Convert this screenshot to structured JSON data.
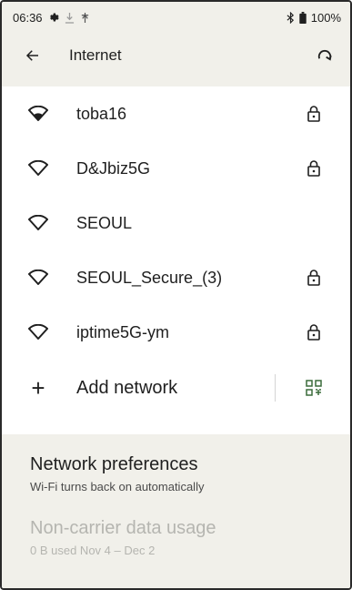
{
  "status_bar": {
    "time": "06:36",
    "battery": "100%"
  },
  "header": {
    "title": "Internet"
  },
  "networks": [
    {
      "name": "toba16",
      "secured": true,
      "connected_style": "filled"
    },
    {
      "name": "D&Jbiz5G",
      "secured": true,
      "connected_style": "outline"
    },
    {
      "name": "SEOUL",
      "secured": false,
      "connected_style": "outline"
    },
    {
      "name": "SEOUL_Secure_(3)",
      "secured": true,
      "connected_style": "outline"
    },
    {
      "name": "iptime5G-ym",
      "secured": true,
      "connected_style": "outline"
    }
  ],
  "add_network": {
    "label": "Add network"
  },
  "preferences": [
    {
      "title": "Network preferences",
      "subtitle": "Wi-Fi turns back on automatically",
      "disabled": false
    },
    {
      "title": "Non-carrier data usage",
      "subtitle": "0 B used Nov 4 – Dec 2",
      "disabled": true
    }
  ],
  "colors": {
    "background": "#f1f0ea",
    "list_background": "#ffffff",
    "text": "#1f1f1f",
    "disabled_text": "#b5b5b0"
  }
}
